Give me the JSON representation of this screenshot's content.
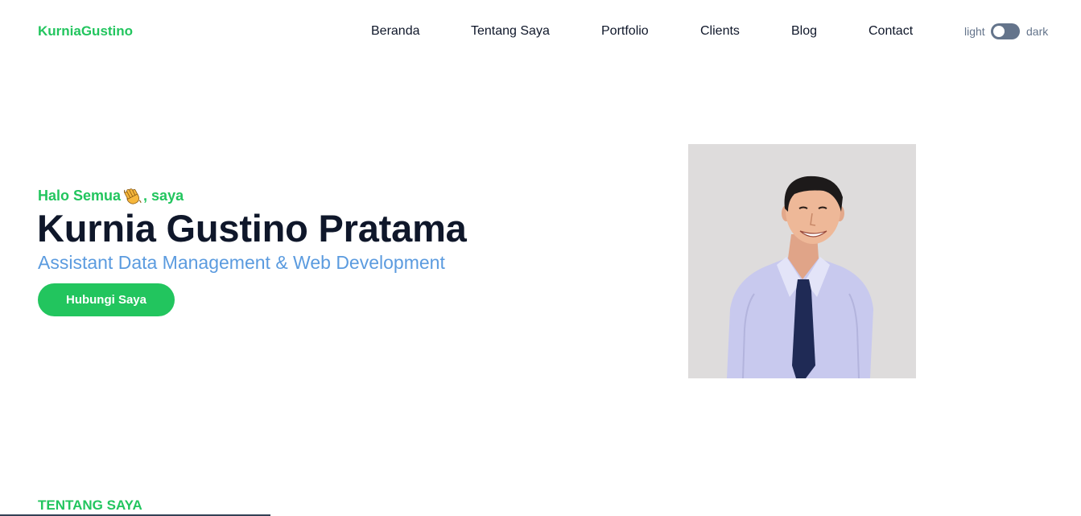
{
  "header": {
    "logo": "KurniaGustino",
    "nav": [
      {
        "label": "Beranda"
      },
      {
        "label": "Tentang Saya"
      },
      {
        "label": "Portfolio"
      },
      {
        "label": "Clients"
      },
      {
        "label": "Blog"
      },
      {
        "label": "Contact"
      }
    ],
    "theme_toggle": {
      "light_label": "light",
      "dark_label": "dark",
      "state": "light"
    }
  },
  "hero": {
    "greeting_before": "Halo Semua",
    "greeting_icon": "waving-hand-icon",
    "greeting_after": ", saya",
    "name": "Kurnia Gustino Pratama",
    "role": "Assistant Data Management & Web Development",
    "cta_label": "Hubungi Saya",
    "photo_alt": "Kurnia Gustino Pratama"
  },
  "about": {
    "heading": "TENTANG SAYA"
  },
  "colors": {
    "accent": "#22c55e",
    "text": "#0f172a",
    "role": "#5b9bdf",
    "muted": "#64748b",
    "photo_bg": "#dedcdc"
  }
}
